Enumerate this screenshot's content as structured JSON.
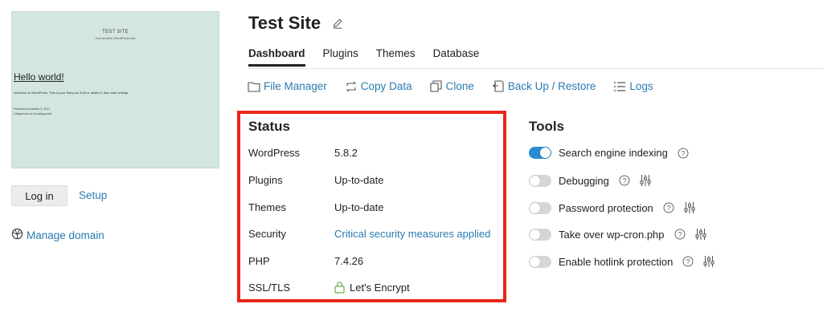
{
  "preview": {
    "site_title": "TEST SITE",
    "tagline": "Just another WordPress site",
    "post_title": "Hello world!",
    "post_excerpt": "Welcome to WordPress. This is your first post. Edit or delete it, then start writing!",
    "post_meta_date": "Published December 5, 2021",
    "post_meta_category": "Categorized as Uncategorized"
  },
  "left": {
    "login_label": "Log in",
    "setup_label": "Setup",
    "manage_domain_label": "Manage domain"
  },
  "header": {
    "title": "Test Site",
    "tabs": [
      {
        "label": "Dashboard",
        "active": true
      },
      {
        "label": "Plugins"
      },
      {
        "label": "Themes"
      },
      {
        "label": "Database"
      }
    ]
  },
  "actions": [
    {
      "label": "File Manager",
      "icon": "folder-icon"
    },
    {
      "label": "Copy Data",
      "icon": "copy-arrows-icon"
    },
    {
      "label": "Clone",
      "icon": "clone-icon"
    },
    {
      "label": "Back Up / Restore",
      "icon": "backup-icon"
    },
    {
      "label": "Logs",
      "icon": "list-icon"
    }
  ],
  "status": {
    "title": "Status",
    "rows": [
      {
        "label": "WordPress",
        "value": "5.8.2"
      },
      {
        "label": "Plugins",
        "value": "Up-to-date"
      },
      {
        "label": "Themes",
        "value": "Up-to-date"
      },
      {
        "label": "Security",
        "value": "Critical security measures applied"
      },
      {
        "label": "PHP",
        "value": "7.4.26"
      },
      {
        "label": "SSL/TLS",
        "value": "Let's Encrypt"
      }
    ]
  },
  "tools": {
    "title": "Tools",
    "items": [
      {
        "label": "Search engine indexing",
        "enabled": true
      },
      {
        "label": "Debugging",
        "enabled": false
      },
      {
        "label": "Password protection",
        "enabled": false
      },
      {
        "label": "Take over wp-cron.php",
        "enabled": false
      },
      {
        "label": "Enable hotlink protection",
        "enabled": false
      }
    ]
  },
  "colors": {
    "link": "#2a7bb0",
    "toggle_on": "#2a8bd2",
    "highlight_border": "#e8261a",
    "preview_bg": "#d3e6df"
  }
}
